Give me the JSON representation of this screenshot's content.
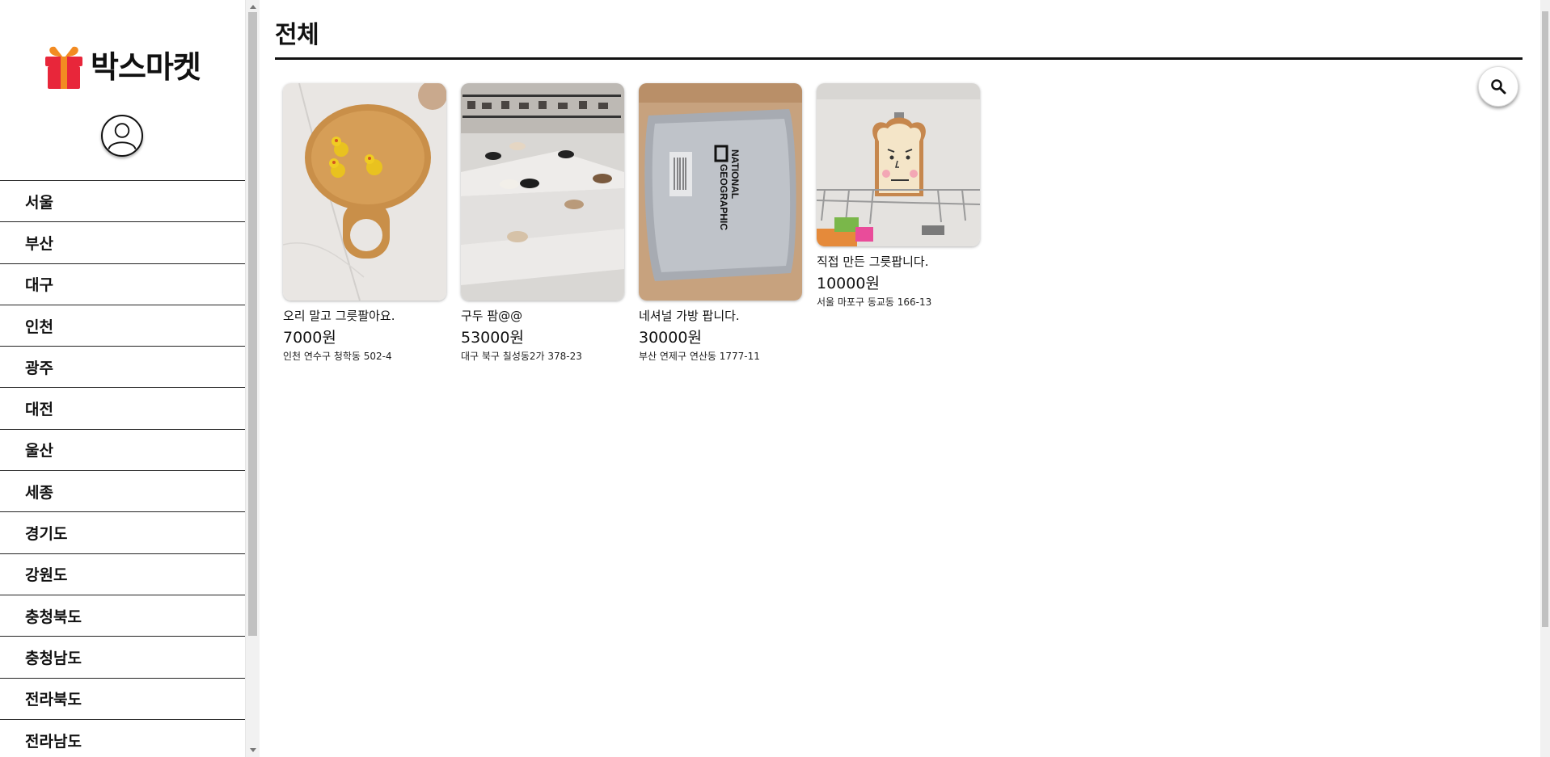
{
  "brand": {
    "name": "박스마켓"
  },
  "sidebar": {
    "regions": [
      "서울",
      "부산",
      "대구",
      "인천",
      "광주",
      "대전",
      "울산",
      "세종",
      "경기도",
      "강원도",
      "충청북도",
      "충청남도",
      "전라북도",
      "전라남도"
    ]
  },
  "main": {
    "title": "전체"
  },
  "icons": {
    "logo": "gift-box-icon",
    "profile": "user-avatar-icon",
    "search": "search-icon"
  },
  "colors": {
    "brand_red": "#e8263a",
    "brand_orange": "#f28b22",
    "text": "#111111"
  },
  "products": [
    {
      "title": "오리 말고 그릇팔아요.",
      "price": "7000원",
      "location": "인천 연수구 청학동 502-4",
      "image": "wooden-board-with-ducks"
    },
    {
      "title": "구두 팜@@",
      "price": "53000원",
      "location": "대구 북구 칠성동2가 378-23",
      "image": "shoe-display-shelves"
    },
    {
      "title": "네셔널 가방 팝니다.",
      "price": "30000원",
      "location": "부산 연제구 연산동 1777-11",
      "image": "national-geographic-bag"
    },
    {
      "title": "직접 만든 그릇팝니다.",
      "price": "10000원",
      "location": "서울 마포구 동교동 166-13",
      "image": "toast-face-dish-on-rack"
    }
  ]
}
